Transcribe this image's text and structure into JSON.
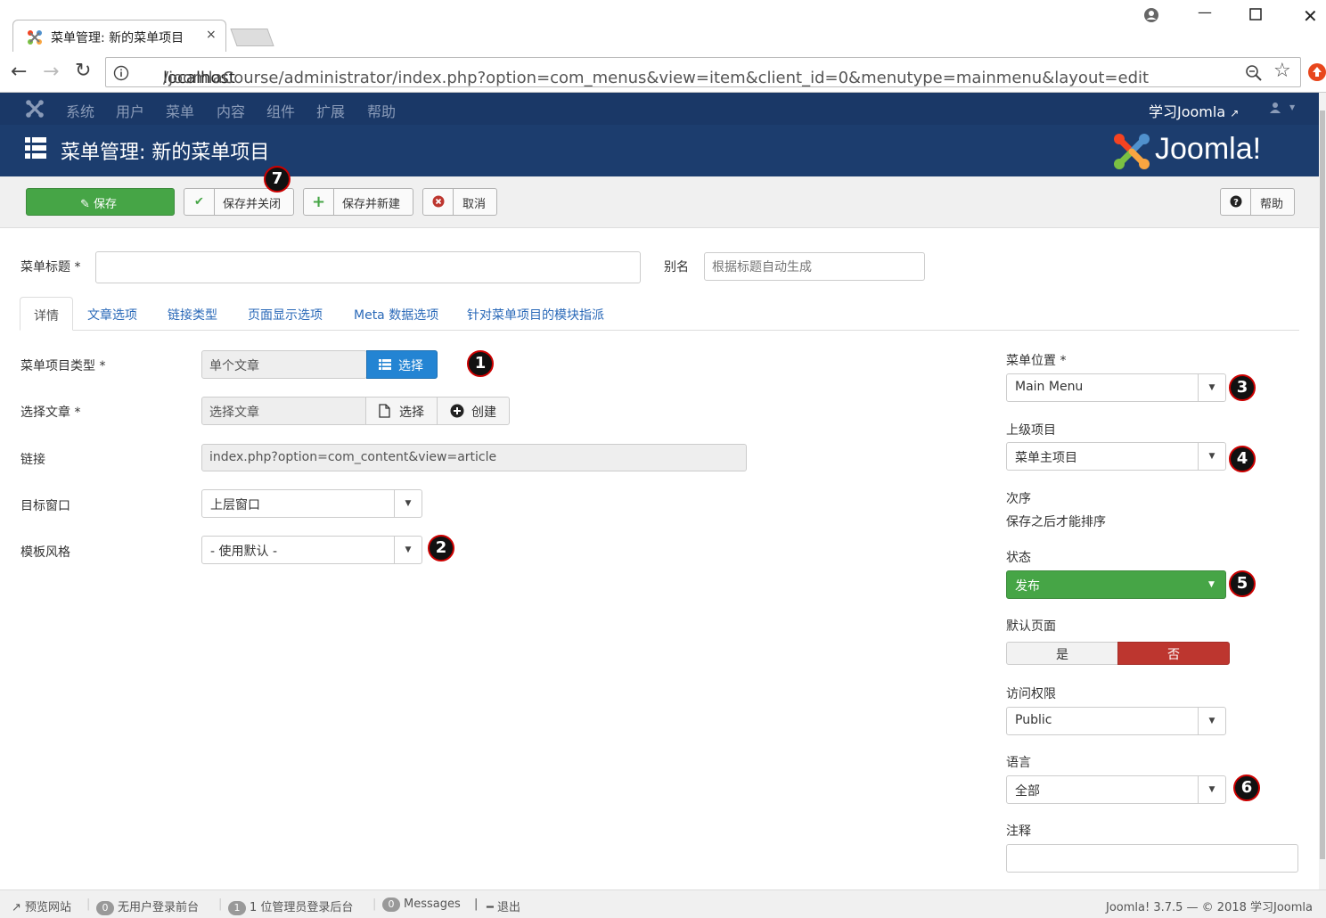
{
  "browser": {
    "tab_title": "菜单管理: 新的菜单项目",
    "tab_close": "×",
    "url_host": "localhost",
    "url_path": "/joomlaCourse/administrator/index.php?option=com_menus&view=item&client_id=0&menutype=mainmenu&layout=edit"
  },
  "admin_nav": {
    "items": [
      "系统",
      "用户",
      "菜单",
      "内容",
      "组件",
      "扩展",
      "帮助"
    ],
    "site_link": "学习Joomla",
    "user_icon": "user-icon"
  },
  "header": {
    "title": "菜单管理: 新的菜单项目",
    "brand": "Joomla!"
  },
  "toolbar": {
    "save": "保存",
    "save_close": "保存并关闭",
    "save_new": "保存并新建",
    "cancel": "取消",
    "help": "帮助"
  },
  "form": {
    "title_label": "菜单标题 *",
    "title_value": "",
    "alias_label": "别名",
    "alias_placeholder": "根据标题自动生成",
    "tabs": [
      "详情",
      "文章选项",
      "链接类型",
      "页面显示选项",
      "Meta 数据选项",
      "针对菜单项目的模块指派"
    ],
    "item_type_label": "菜单项目类型 *",
    "item_type_value": "单个文章",
    "item_type_select": "选择",
    "article_label": "选择文章 *",
    "article_value": "选择文章",
    "article_select": "选择",
    "article_create": "创建",
    "link_label": "链接",
    "link_value": "index.php?option=com_content&view=article",
    "target_label": "目标窗口",
    "target_value": "上层窗口",
    "template_label": "模板风格",
    "template_value": "- 使用默认 -"
  },
  "sidebar": {
    "menu_label": "菜单位置 *",
    "menu_value": "Main Menu",
    "parent_label": "上级项目",
    "parent_value": "菜单主项目",
    "order_label": "次序",
    "order_note": "保存之后才能排序",
    "status_label": "状态",
    "status_value": "发布",
    "default_label": "默认页面",
    "default_yes": "是",
    "default_no": "否",
    "access_label": "访问权限",
    "access_value": "Public",
    "language_label": "语言",
    "language_value": "全部",
    "note_label": "注释",
    "note_value": ""
  },
  "annotations": [
    "1",
    "2",
    "3",
    "4",
    "5",
    "6",
    "7"
  ],
  "statusbar": {
    "preview": "预览网站",
    "front_count": "0",
    "front_text": "无用户登录前台",
    "back_count": "1",
    "back_text": "1 位管理员登录后台",
    "msg_count": "0",
    "msg_text": "Messages",
    "logout": "退出",
    "version": "Joomla! 3.7.5 — © 2018 学习Joomla"
  },
  "colors": {
    "nav_bg": "#1a3867",
    "header_bg": "#1c3d6e",
    "save_green": "#46a546",
    "select_blue": "#2384d3",
    "no_red": "#bd362f"
  }
}
